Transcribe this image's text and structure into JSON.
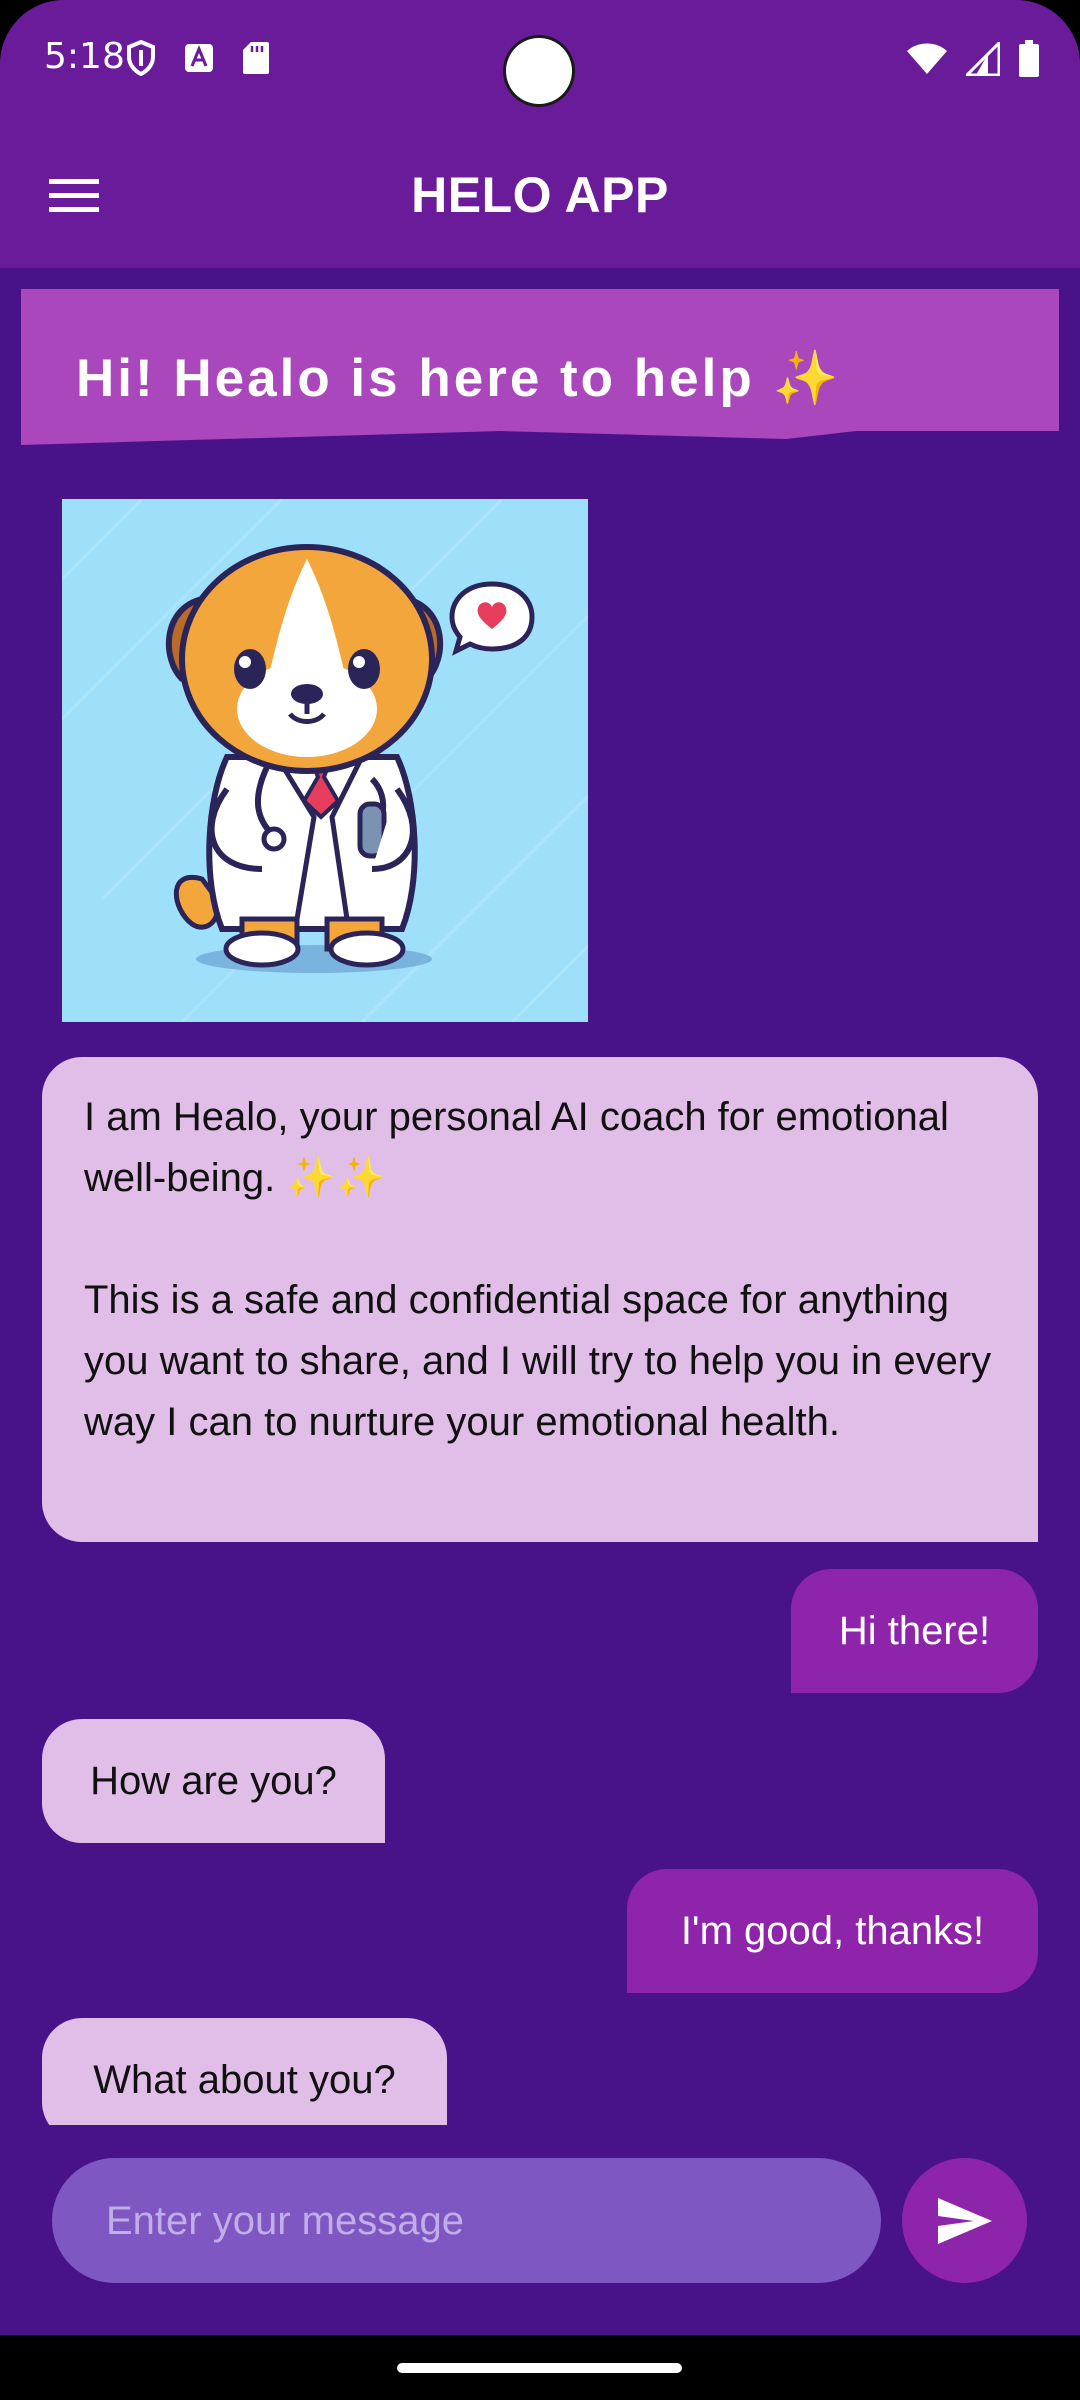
{
  "status_bar": {
    "time": "5:18",
    "left_icons": [
      "shield-icon",
      "font-a-icon",
      "sd-card-icon"
    ],
    "right_icons": [
      "wifi-icon",
      "signal-icon",
      "battery-icon"
    ]
  },
  "app_bar": {
    "title": "HELO APP",
    "menu_icon": "hamburger-menu-icon"
  },
  "banner": {
    "text": "Hi! Healo is here to help ✨"
  },
  "mascot": {
    "icon": "dog-doctor-mascot",
    "speech_icon": "heart-speech-bubble-icon"
  },
  "messages": [
    {
      "sender": "bot",
      "text": "I am Healo, your personal AI coach for emotional well-being. ✨✨\n\nThis is a safe and confidential space for anything you want to share, and I will try to help you in every way I can to nurture your emotional health."
    },
    {
      "sender": "user",
      "text": "Hi there!"
    },
    {
      "sender": "bot",
      "text": "How are you?"
    },
    {
      "sender": "user",
      "text": "I'm good, thanks!"
    },
    {
      "sender": "bot",
      "text": "What about you?"
    }
  ],
  "composer": {
    "placeholder": "Enter your message",
    "value": "",
    "send_icon": "send-icon"
  },
  "colors": {
    "background": "#481388",
    "app_bar": "#6a1b9a",
    "banner": "#ab47bc",
    "bot_bubble": "#e1bee7",
    "user_bubble": "#8e24aa",
    "input_field": "#7e57c2"
  }
}
